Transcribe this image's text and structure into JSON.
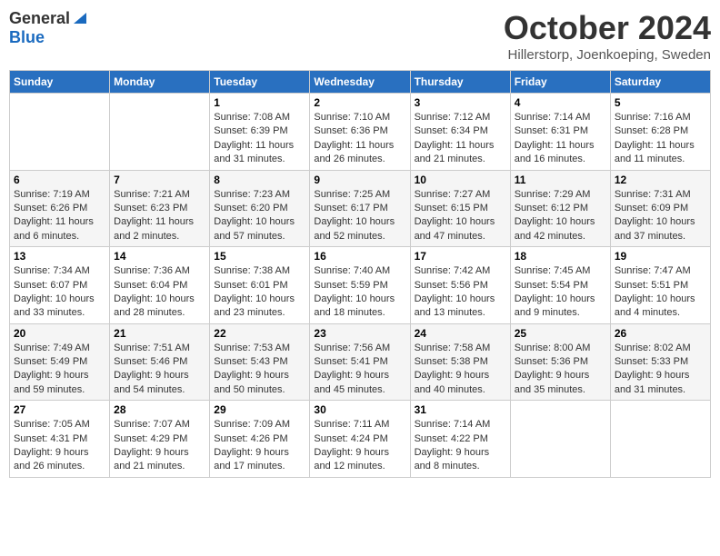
{
  "header": {
    "logo_general": "General",
    "logo_blue": "Blue",
    "title": "October 2024",
    "location": "Hillerstorp, Joenkoeping, Sweden"
  },
  "weekdays": [
    "Sunday",
    "Monday",
    "Tuesday",
    "Wednesday",
    "Thursday",
    "Friday",
    "Saturday"
  ],
  "weeks": [
    [
      {
        "day": "",
        "info": ""
      },
      {
        "day": "",
        "info": ""
      },
      {
        "day": "1",
        "info": "Sunrise: 7:08 AM\nSunset: 6:39 PM\nDaylight: 11 hours and 31 minutes."
      },
      {
        "day": "2",
        "info": "Sunrise: 7:10 AM\nSunset: 6:36 PM\nDaylight: 11 hours and 26 minutes."
      },
      {
        "day": "3",
        "info": "Sunrise: 7:12 AM\nSunset: 6:34 PM\nDaylight: 11 hours and 21 minutes."
      },
      {
        "day": "4",
        "info": "Sunrise: 7:14 AM\nSunset: 6:31 PM\nDaylight: 11 hours and 16 minutes."
      },
      {
        "day": "5",
        "info": "Sunrise: 7:16 AM\nSunset: 6:28 PM\nDaylight: 11 hours and 11 minutes."
      }
    ],
    [
      {
        "day": "6",
        "info": "Sunrise: 7:19 AM\nSunset: 6:26 PM\nDaylight: 11 hours and 6 minutes."
      },
      {
        "day": "7",
        "info": "Sunrise: 7:21 AM\nSunset: 6:23 PM\nDaylight: 11 hours and 2 minutes."
      },
      {
        "day": "8",
        "info": "Sunrise: 7:23 AM\nSunset: 6:20 PM\nDaylight: 10 hours and 57 minutes."
      },
      {
        "day": "9",
        "info": "Sunrise: 7:25 AM\nSunset: 6:17 PM\nDaylight: 10 hours and 52 minutes."
      },
      {
        "day": "10",
        "info": "Sunrise: 7:27 AM\nSunset: 6:15 PM\nDaylight: 10 hours and 47 minutes."
      },
      {
        "day": "11",
        "info": "Sunrise: 7:29 AM\nSunset: 6:12 PM\nDaylight: 10 hours and 42 minutes."
      },
      {
        "day": "12",
        "info": "Sunrise: 7:31 AM\nSunset: 6:09 PM\nDaylight: 10 hours and 37 minutes."
      }
    ],
    [
      {
        "day": "13",
        "info": "Sunrise: 7:34 AM\nSunset: 6:07 PM\nDaylight: 10 hours and 33 minutes."
      },
      {
        "day": "14",
        "info": "Sunrise: 7:36 AM\nSunset: 6:04 PM\nDaylight: 10 hours and 28 minutes."
      },
      {
        "day": "15",
        "info": "Sunrise: 7:38 AM\nSunset: 6:01 PM\nDaylight: 10 hours and 23 minutes."
      },
      {
        "day": "16",
        "info": "Sunrise: 7:40 AM\nSunset: 5:59 PM\nDaylight: 10 hours and 18 minutes."
      },
      {
        "day": "17",
        "info": "Sunrise: 7:42 AM\nSunset: 5:56 PM\nDaylight: 10 hours and 13 minutes."
      },
      {
        "day": "18",
        "info": "Sunrise: 7:45 AM\nSunset: 5:54 PM\nDaylight: 10 hours and 9 minutes."
      },
      {
        "day": "19",
        "info": "Sunrise: 7:47 AM\nSunset: 5:51 PM\nDaylight: 10 hours and 4 minutes."
      }
    ],
    [
      {
        "day": "20",
        "info": "Sunrise: 7:49 AM\nSunset: 5:49 PM\nDaylight: 9 hours and 59 minutes."
      },
      {
        "day": "21",
        "info": "Sunrise: 7:51 AM\nSunset: 5:46 PM\nDaylight: 9 hours and 54 minutes."
      },
      {
        "day": "22",
        "info": "Sunrise: 7:53 AM\nSunset: 5:43 PM\nDaylight: 9 hours and 50 minutes."
      },
      {
        "day": "23",
        "info": "Sunrise: 7:56 AM\nSunset: 5:41 PM\nDaylight: 9 hours and 45 minutes."
      },
      {
        "day": "24",
        "info": "Sunrise: 7:58 AM\nSunset: 5:38 PM\nDaylight: 9 hours and 40 minutes."
      },
      {
        "day": "25",
        "info": "Sunrise: 8:00 AM\nSunset: 5:36 PM\nDaylight: 9 hours and 35 minutes."
      },
      {
        "day": "26",
        "info": "Sunrise: 8:02 AM\nSunset: 5:33 PM\nDaylight: 9 hours and 31 minutes."
      }
    ],
    [
      {
        "day": "27",
        "info": "Sunrise: 7:05 AM\nSunset: 4:31 PM\nDaylight: 9 hours and 26 minutes."
      },
      {
        "day": "28",
        "info": "Sunrise: 7:07 AM\nSunset: 4:29 PM\nDaylight: 9 hours and 21 minutes."
      },
      {
        "day": "29",
        "info": "Sunrise: 7:09 AM\nSunset: 4:26 PM\nDaylight: 9 hours and 17 minutes."
      },
      {
        "day": "30",
        "info": "Sunrise: 7:11 AM\nSunset: 4:24 PM\nDaylight: 9 hours and 12 minutes."
      },
      {
        "day": "31",
        "info": "Sunrise: 7:14 AM\nSunset: 4:22 PM\nDaylight: 9 hours and 8 minutes."
      },
      {
        "day": "",
        "info": ""
      },
      {
        "day": "",
        "info": ""
      }
    ]
  ]
}
